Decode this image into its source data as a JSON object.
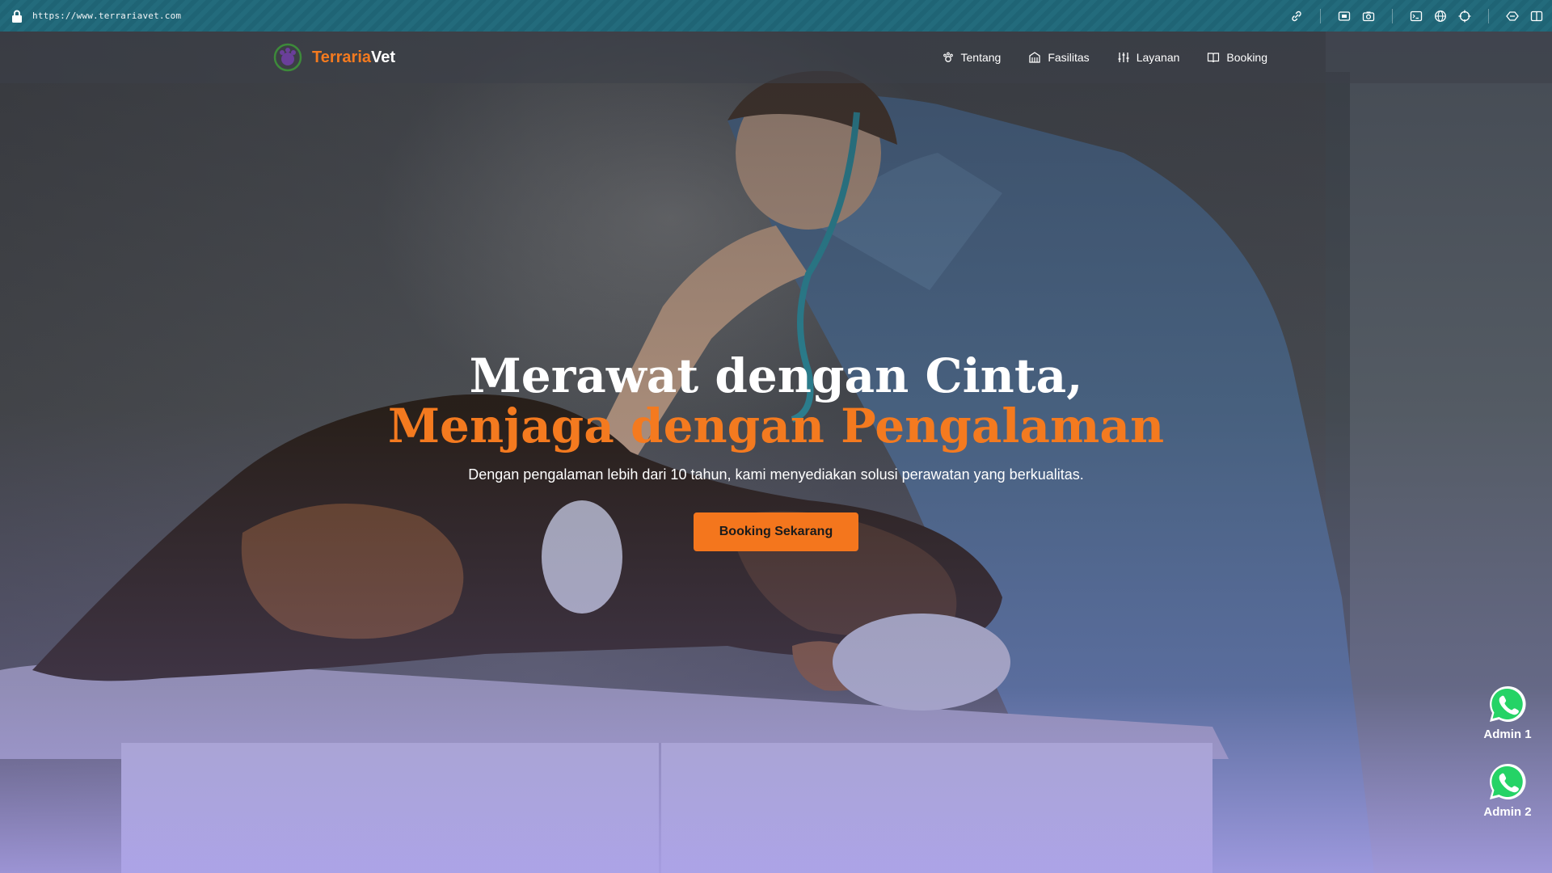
{
  "browser": {
    "url": "https://www.terrariavet.com",
    "tools": [
      "link-icon",
      "screenshot-icon",
      "camera-icon",
      "terminal-icon",
      "globe-icon",
      "crosshair-icon",
      "extensions-icon",
      "sidebar-icon"
    ]
  },
  "nav": {
    "brand_part1": "Terraria",
    "brand_part2": "Vet",
    "items": [
      {
        "label": "Tentang",
        "icon": "paw-icon"
      },
      {
        "label": "Fasilitas",
        "icon": "building-icon"
      },
      {
        "label": "Layanan",
        "icon": "sliders-icon"
      },
      {
        "label": "Booking",
        "icon": "book-icon"
      }
    ]
  },
  "hero": {
    "title_line1": "Merawat dengan Cinta,",
    "title_line2": "Menjaga dengan Pengalaman",
    "subtitle": "Dengan pengalaman lebih dari 10 tahun, kami menyediakan solusi perawatan yang berkualitas.",
    "cta_label": "Booking Sekarang"
  },
  "whatsapp": [
    {
      "label": "Admin 1"
    },
    {
      "label": "Admin 2"
    }
  ],
  "colors": {
    "accent": "#f47a1f",
    "whatsapp": "#25d366",
    "browser_bar": "#1f6475"
  }
}
